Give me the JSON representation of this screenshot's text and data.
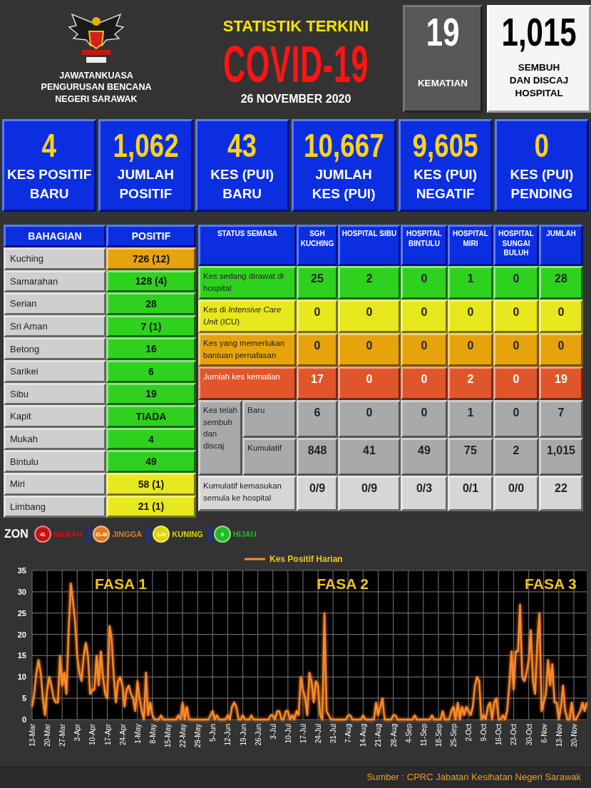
{
  "header": {
    "org_name_lines": [
      "JAWATANKUASA",
      "PENGURUSAN BENCANA",
      "NEGERI SARAWAK"
    ],
    "title": "STATISTIK TERKINI",
    "headline": "COVID-19",
    "date": "26 NOVEMBER 2020",
    "deaths": {
      "value": "19",
      "label_lines": [
        "KEMATIAN"
      ]
    },
    "recovered": {
      "value": "1,015",
      "label_lines": [
        "SEMBUH",
        "DAN DISCAJ",
        "HOSPITAL"
      ]
    }
  },
  "summary_tiles": [
    {
      "value": "4",
      "label_lines": [
        "KES POSITIF",
        "BARU"
      ]
    },
    {
      "value": "1,062",
      "label_lines": [
        "JUMLAH",
        "POSITIF"
      ]
    },
    {
      "value": "43",
      "label_lines": [
        "KES (PUI)",
        "BARU"
      ]
    },
    {
      "value": "10,667",
      "label_lines": [
        "JUMLAH",
        "KES (PUI)"
      ]
    },
    {
      "value": "9,605",
      "label_lines": [
        "KES (PUI)",
        "NEGATIF"
      ]
    },
    {
      "value": "0",
      "label_lines": [
        "KES (PUI)",
        "PENDING"
      ]
    }
  ],
  "division_table": {
    "columns": [
      "BAHAGIAN",
      "POSITIF"
    ],
    "rows": [
      {
        "division": "Kuching",
        "positive": "726 (12)",
        "color": "#e6a30c"
      },
      {
        "division": "Samarahan",
        "positive": "128 (4)",
        "color": "#2fd11f"
      },
      {
        "division": "Serian",
        "positive": "28",
        "color": "#2fd11f"
      },
      {
        "division": "Sri Aman",
        "positive": "7 (1)",
        "color": "#2fd11f"
      },
      {
        "division": "Betong",
        "positive": "16",
        "color": "#2fd11f"
      },
      {
        "division": "Sarikei",
        "positive": "6",
        "color": "#2fd11f"
      },
      {
        "division": "Sibu",
        "positive": "19",
        "color": "#2fd11f"
      },
      {
        "division": "Kapit",
        "positive": "TIADA",
        "color": "#2fd11f"
      },
      {
        "division": "Mukah",
        "positive": "4",
        "color": "#2fd11f"
      },
      {
        "division": "Bintulu",
        "positive": "49",
        "color": "#2fd11f"
      },
      {
        "division": "Miri",
        "positive": "58 (1)",
        "color": "#e8e81e"
      },
      {
        "division": "Limbang",
        "positive": "21 (1)",
        "color": "#e8e81e"
      }
    ]
  },
  "status_table": {
    "columns": [
      "STATUS SEMASA",
      "SGH KUCHING",
      "HOSPITAL SIBU",
      "HOSPITAL BINTULU",
      "HOSPITAL MIRI",
      "HOSPITAL SUNGAI BULUH",
      "JUMLAH"
    ],
    "rows": [
      {
        "kind": "single",
        "label": "Kes sedang dirawat di hospital",
        "color": "#2fd11f",
        "values": [
          "25",
          "2",
          "0",
          "1",
          "0",
          "28"
        ]
      },
      {
        "kind": "single",
        "label": "Kes di *Intensive Care Unit* (ICU)",
        "color": "#e8e81e",
        "values": [
          "0",
          "0",
          "0",
          "0",
          "0",
          "0"
        ]
      },
      {
        "kind": "single",
        "label": "Kes yang memerlukan bantuan pernafasan",
        "color": "#e6a30c",
        "values": [
          "0",
          "0",
          "0",
          "0",
          "0",
          "0"
        ]
      },
      {
        "kind": "single",
        "label": "Jumlah kes kematian",
        "color": "#e0562a",
        "values": [
          "17",
          "0",
          "0",
          "2",
          "0",
          "19"
        ]
      },
      {
        "kind": "group",
        "label": "Kes telah sembuh dan discaj",
        "color": "#a9a9a9",
        "subrows": [
          {
            "label": "Baru",
            "values": [
              "6",
              "0",
              "0",
              "1",
              "0",
              "7"
            ]
          },
          {
            "label": "Kumulatif",
            "values": [
              "848",
              "41",
              "49",
              "75",
              "2",
              "1,015"
            ]
          }
        ]
      },
      {
        "kind": "single",
        "label": "Kumulatif kemasukan semula ke hospital",
        "color": "#d6d6d6",
        "values": [
          "0/9",
          "0/9",
          "0/3",
          "0/1",
          "0/0",
          "22"
        ]
      }
    ]
  },
  "zone_legend": {
    "title": "ZON",
    "items": [
      {
        "badge": "41",
        "label": "MERAH",
        "color": "#cc1111"
      },
      {
        "badge": "21-40",
        "label": "JINGGA",
        "color": "#e07b20"
      },
      {
        "badge": "1-20",
        "label": "KUNING",
        "color": "#e0d400"
      },
      {
        "badge": "0",
        "label": "HIJAU",
        "color": "#22bb22"
      }
    ]
  },
  "chart": {
    "chart_data": {
      "type": "line",
      "ylim": [
        0,
        35
      ],
      "yticks": [
        0,
        5,
        10,
        15,
        20,
        25,
        30,
        35
      ],
      "grid": true,
      "categories": [
        "13-Mar",
        null,
        null,
        null,
        null,
        null,
        null,
        "20-Mar",
        null,
        null,
        null,
        null,
        null,
        null,
        "27-Mar",
        null,
        null,
        null,
        null,
        null,
        null,
        "3-Apr",
        null,
        null,
        null,
        null,
        null,
        null,
        "10-Apr",
        null,
        null,
        null,
        null,
        null,
        null,
        "17-Apr",
        null,
        null,
        null,
        null,
        null,
        null,
        "24-Apr",
        null,
        null,
        null,
        null,
        null,
        null,
        "1-May",
        null,
        null,
        null,
        null,
        null,
        null,
        "8-May",
        null,
        null,
        null,
        null,
        null,
        null,
        "15-May",
        null,
        null,
        null,
        null,
        null,
        null,
        "22-May",
        null,
        null,
        null,
        null,
        null,
        null,
        "29-May",
        null,
        null,
        null,
        null,
        null,
        null,
        "5-Jun",
        null,
        null,
        null,
        null,
        null,
        null,
        "12-Jun",
        null,
        null,
        null,
        null,
        null,
        null,
        "19-Jun",
        null,
        null,
        null,
        null,
        null,
        null,
        "26-Jun",
        null,
        null,
        null,
        null,
        null,
        null,
        "3-Jul",
        null,
        null,
        null,
        null,
        null,
        null,
        "10-Jul",
        null,
        null,
        null,
        null,
        null,
        null,
        "17-Jul",
        null,
        null,
        null,
        null,
        null,
        null,
        "24-Jul",
        null,
        null,
        null,
        null,
        null,
        null,
        "31-Jul",
        null,
        null,
        null,
        null,
        null,
        null,
        "7-Aug",
        null,
        null,
        null,
        null,
        null,
        null,
        "14-Aug",
        null,
        null,
        null,
        null,
        null,
        null,
        "21-Aug",
        null,
        null,
        null,
        null,
        null,
        null,
        "28-Aug",
        null,
        null,
        null,
        null,
        null,
        null,
        "4-Sep",
        null,
        null,
        null,
        null,
        null,
        null,
        "11-Sep",
        null,
        null,
        null,
        null,
        null,
        null,
        "18-Sep",
        null,
        null,
        null,
        null,
        null,
        null,
        "25-Sep",
        null,
        null,
        null,
        null,
        null,
        null,
        "2-Oct",
        null,
        null,
        null,
        null,
        null,
        null,
        "9-Oct",
        null,
        null,
        null,
        null,
        null,
        null,
        "16-Oct",
        null,
        null,
        null,
        null,
        null,
        null,
        "23-Oct",
        null,
        null,
        null,
        null,
        null,
        null,
        "30-Oct",
        null,
        null,
        null,
        null,
        null,
        null,
        "6-Nov",
        null,
        null,
        null,
        null,
        null,
        null,
        "13-Nov",
        null,
        null,
        null,
        null,
        null,
        null,
        "20-Nov",
        null,
        null,
        null,
        null,
        null,
        null
      ],
      "series": [
        {
          "name": "Kes Positif Harian",
          "color": "#ff8a2a",
          "values": [
            3,
            6,
            11,
            14,
            11,
            5,
            1,
            7,
            10,
            8,
            5,
            4,
            4,
            15,
            8,
            11,
            6,
            21,
            32,
            28,
            23,
            15,
            11,
            9,
            15,
            18,
            15,
            6,
            7,
            7,
            15,
            8,
            16,
            10,
            6,
            5,
            22,
            19,
            10,
            4,
            9,
            10,
            8,
            3,
            7,
            8,
            6,
            5,
            2,
            9,
            5,
            2,
            0,
            11,
            1,
            4,
            1,
            0,
            0,
            0,
            1,
            0,
            0,
            0,
            0,
            0,
            0,
            0,
            1,
            0,
            4,
            0,
            3,
            0,
            0,
            0,
            0,
            0,
            0,
            0,
            0,
            0,
            0,
            1,
            2,
            0,
            1,
            0,
            0,
            0,
            0,
            1,
            0,
            3,
            4,
            3,
            0,
            0,
            1,
            0,
            0,
            0,
            1,
            0,
            0,
            0,
            0,
            0,
            0,
            0,
            0,
            1,
            1,
            0,
            2,
            2,
            0,
            0,
            2,
            2,
            0,
            1,
            0,
            2,
            1,
            10,
            7,
            5,
            1,
            11,
            9,
            4,
            9,
            8,
            1,
            0,
            25,
            2,
            1,
            0,
            0,
            0,
            0,
            0,
            0,
            0,
            0,
            1,
            1,
            0,
            0,
            0,
            0,
            0,
            1,
            0,
            0,
            0,
            0,
            0,
            4,
            1,
            3,
            5,
            0,
            0,
            0,
            0,
            1,
            1,
            0,
            0,
            0,
            0,
            0,
            0,
            0,
            0,
            1,
            0,
            0,
            0,
            0,
            0,
            0,
            0,
            1,
            0,
            0,
            0,
            0,
            2,
            0,
            0,
            0,
            2,
            3,
            0,
            4,
            0,
            3,
            1,
            3,
            2,
            1,
            3,
            8,
            10,
            9,
            0,
            1,
            0,
            3,
            4,
            0,
            4,
            5,
            0,
            0,
            1,
            0,
            2,
            8,
            16,
            7,
            16,
            16,
            27,
            10,
            9,
            11,
            14,
            21,
            9,
            6,
            18,
            25,
            2,
            4,
            6,
            14,
            8,
            13,
            4,
            4,
            0,
            3,
            8,
            2,
            0,
            0,
            4,
            0,
            0,
            1,
            2,
            4,
            2,
            4
          ]
        }
      ],
      "annotations": [
        {
          "text": "FASA 1"
        },
        {
          "text": "FASA 2"
        },
        {
          "text": "FASA 3"
        }
      ]
    }
  },
  "source": "Sumber : CPRC Jabatan Kesihatan Negeri Sarawak"
}
